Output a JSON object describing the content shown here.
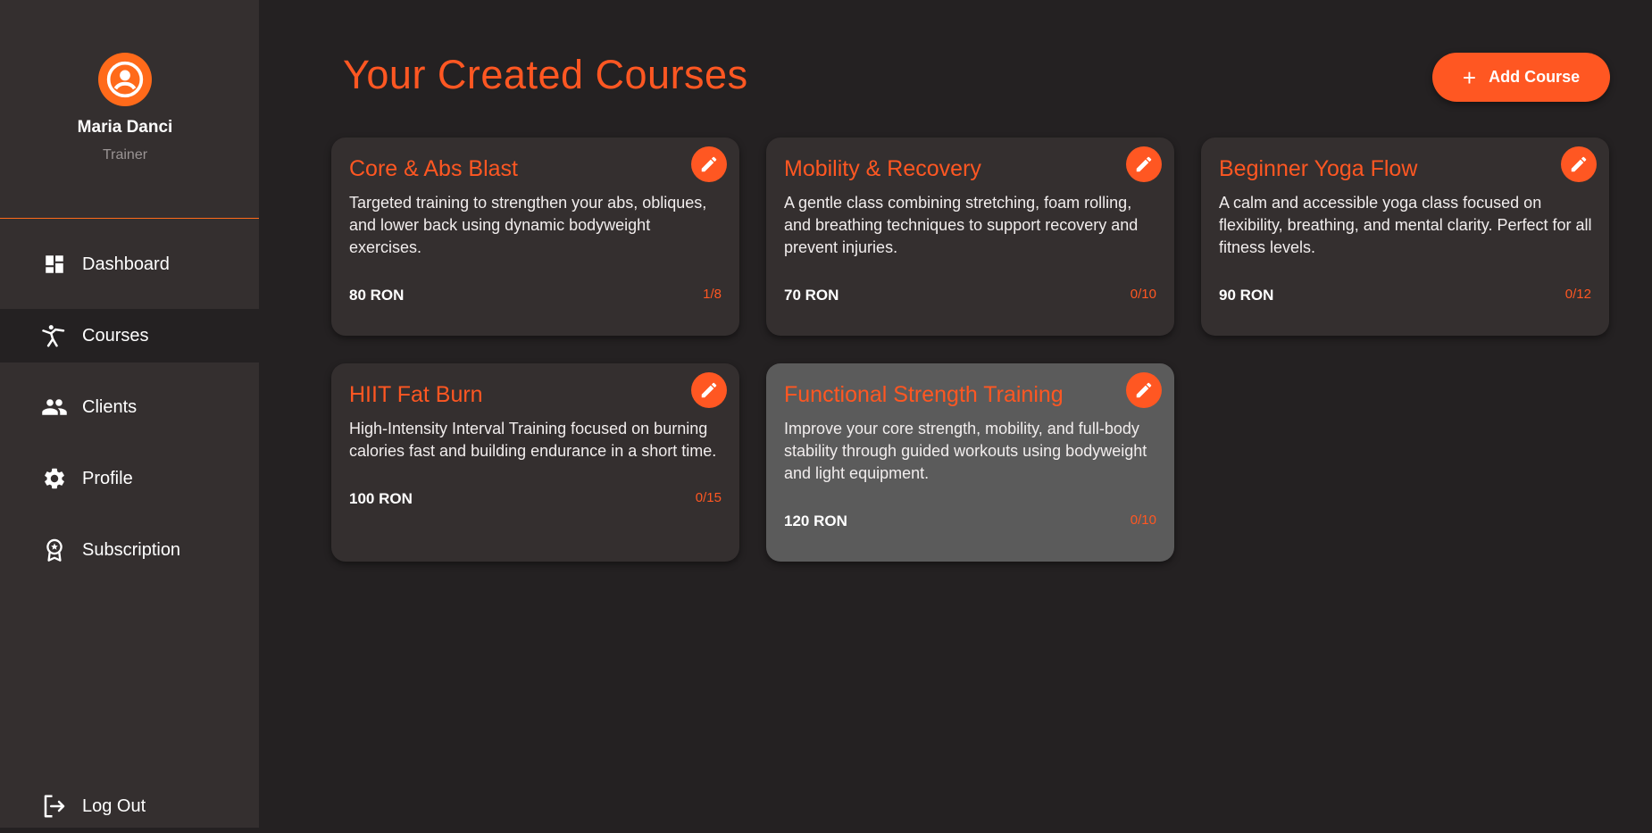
{
  "user": {
    "name": "Maria Danci",
    "role": "Trainer"
  },
  "nav": {
    "items": [
      {
        "label": "Dashboard",
        "icon": "dashboard-icon",
        "active": false
      },
      {
        "label": "Courses",
        "icon": "martial-arts-icon",
        "active": true
      },
      {
        "label": "Clients",
        "icon": "people-icon",
        "active": false
      },
      {
        "label": "Profile",
        "icon": "gear-icon",
        "active": false
      },
      {
        "label": "Subscription",
        "icon": "award-icon",
        "active": false
      }
    ],
    "logout": {
      "label": "Log Out",
      "icon": "logout-icon"
    }
  },
  "main": {
    "title": "Your Created Courses",
    "add_button": {
      "label": "Add Course",
      "icon": "plus-icon"
    }
  },
  "courses": [
    {
      "title": "Core & Abs Blast",
      "description": "Targeted training to strengthen your abs, obliques, and lower back using dynamic bodyweight exercises.",
      "price": "80 RON",
      "capacity": "1/8"
    },
    {
      "title": "Mobility & Recovery",
      "description": "A gentle class combining stretching, foam rolling, and breathing techniques to support recovery and prevent injuries.",
      "price": "70 RON",
      "capacity": "0/10"
    },
    {
      "title": "Beginner Yoga Flow",
      "description": "A calm and accessible yoga class focused on flexibility, breathing, and mental clarity. Perfect for all fitness levels.",
      "price": "90 RON",
      "capacity": "0/12"
    },
    {
      "title": "HIIT Fat Burn",
      "description": "High-Intensity Interval Training focused on burning calories fast and building endurance in a short time.",
      "price": "100 RON",
      "capacity": "0/15"
    },
    {
      "title": "Functional Strength Training",
      "description": "Improve your core strength, mobility, and full-body stability through guided workouts using bodyweight and light equipment.",
      "price": "120 RON",
      "capacity": "0/10"
    }
  ],
  "colors": {
    "accent": "#ff5722",
    "sidebar_bg": "#342f2f",
    "page_bg": "#242122",
    "card_bg": "#342f2f",
    "card_hover_bg": "#5b5b5b"
  }
}
